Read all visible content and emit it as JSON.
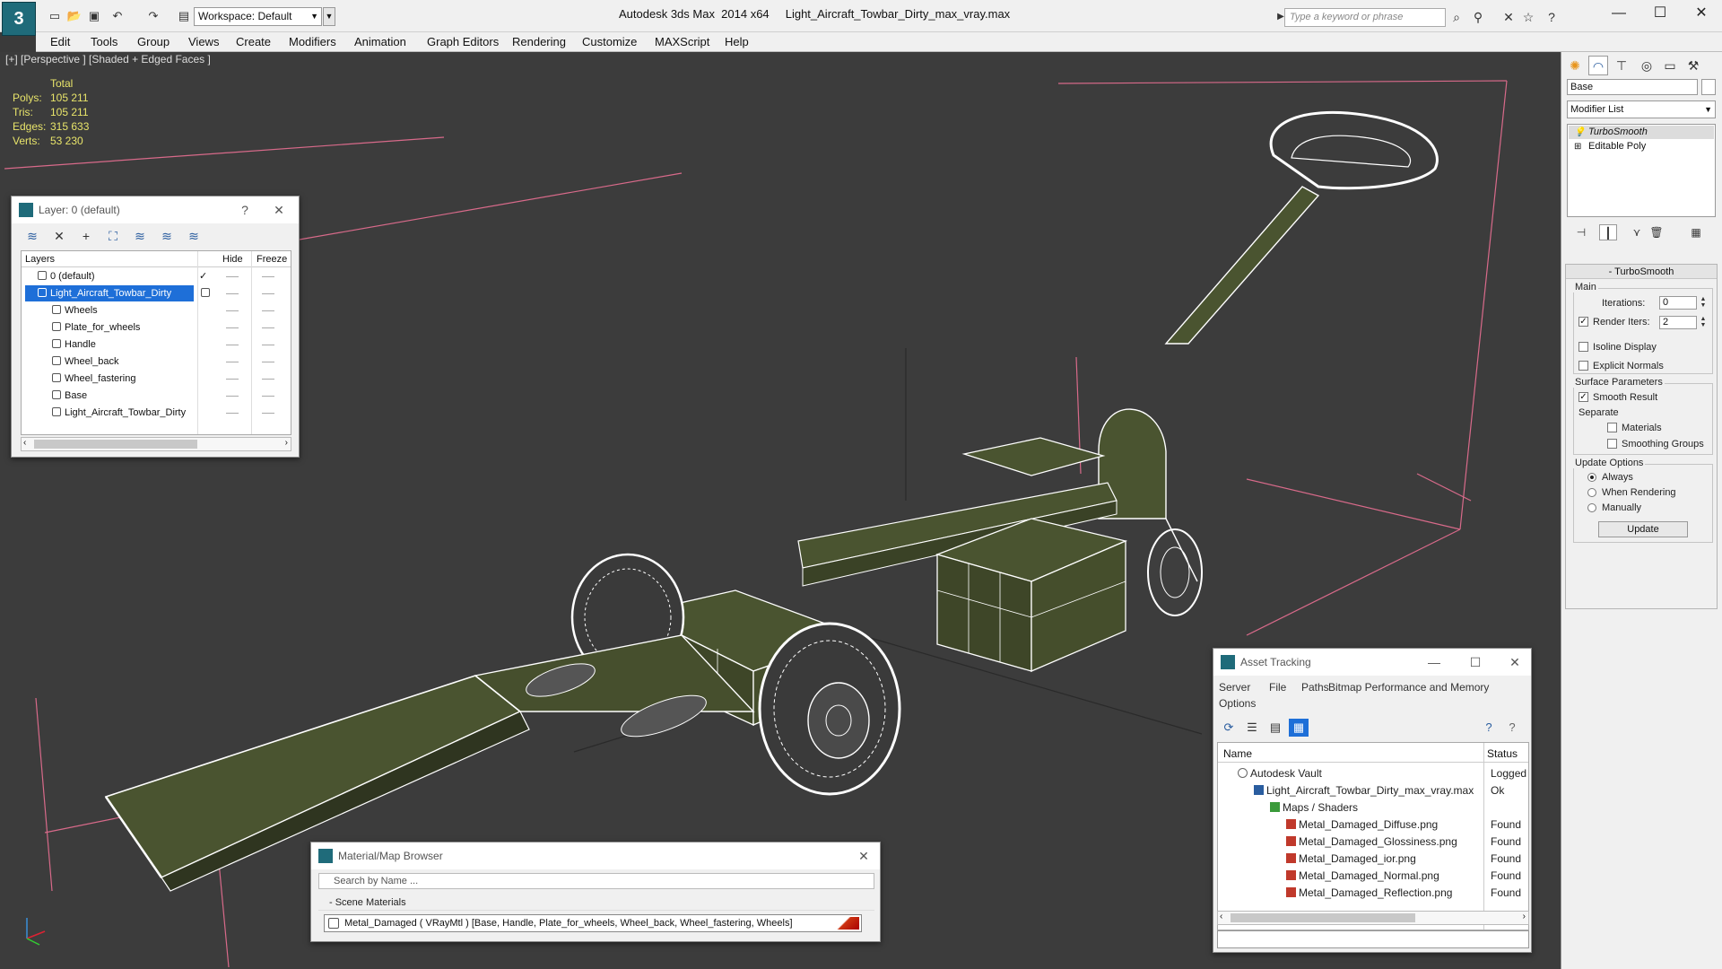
{
  "window": {
    "title": "Autodesk 3ds Max  2014 x64     Light_Aircraft_Towbar_Dirty_max_vray.max",
    "workspace": "Workspace: Default",
    "search_placeholder": "Type a keyword or phrase"
  },
  "menu": [
    "Edit",
    "Tools",
    "Group",
    "Views",
    "Create",
    "Modifiers",
    "Animation",
    "Graph Editors",
    "Rendering",
    "Customize",
    "MAXScript",
    "Help"
  ],
  "viewport": {
    "label": "[+] [Perspective ] [Shaded + Edged Faces ]",
    "stats": {
      "header": "Total",
      "rows": [
        {
          "key": "Polys:",
          "value": "105 211"
        },
        {
          "key": "Tris:",
          "value": "105 211"
        },
        {
          "key": "Edges:",
          "value": "315 633"
        },
        {
          "key": "Verts:",
          "value": "53 230"
        }
      ]
    }
  },
  "layer_panel": {
    "title": "Layer: 0 (default)",
    "help": "?",
    "columns": {
      "layers": "Layers",
      "hide": "Hide",
      "freeze": "Freeze"
    },
    "rows": [
      {
        "name": "0 (default)",
        "level": 0,
        "checked": true
      },
      {
        "name": "Light_Aircraft_Towbar_Dirty",
        "level": 0,
        "selected": true
      },
      {
        "name": "Wheels",
        "level": 1
      },
      {
        "name": "Plate_for_wheels",
        "level": 1
      },
      {
        "name": "Handle",
        "level": 1
      },
      {
        "name": "Wheel_back",
        "level": 1
      },
      {
        "name": "Wheel_fastering",
        "level": 1
      },
      {
        "name": "Base",
        "level": 1
      },
      {
        "name": "Light_Aircraft_Towbar_Dirty",
        "level": 1
      }
    ]
  },
  "material_browser": {
    "title": "Material/Map Browser",
    "search": "Search by Name ...",
    "section": "- Scene Materials",
    "material": "Metal_Damaged  ( VRayMtl ) [Base, Handle, Plate_for_wheels, Wheel_back, Wheel_fastering, Wheels]"
  },
  "asset_tracking": {
    "title": "Asset Tracking",
    "menu": [
      "Server",
      "File",
      "Paths",
      "Bitmap Performance and Memory",
      "Options"
    ],
    "columns": {
      "name": "Name",
      "status": "Status"
    },
    "rows": [
      {
        "name": "Autodesk Vault",
        "status": "Logged O",
        "level": 1,
        "icon": "vault"
      },
      {
        "name": "Light_Aircraft_Towbar_Dirty_max_vray.max",
        "status": "Ok",
        "level": 2,
        "icon": "max"
      },
      {
        "name": "Maps / Shaders",
        "status": "",
        "level": 3,
        "icon": "maps"
      },
      {
        "name": "Metal_Damaged_Diffuse.png",
        "status": "Found",
        "level": 4,
        "icon": "png"
      },
      {
        "name": "Metal_Damaged_Glossiness.png",
        "status": "Found",
        "level": 4,
        "icon": "png"
      },
      {
        "name": "Metal_Damaged_ior.png",
        "status": "Found",
        "level": 4,
        "icon": "png"
      },
      {
        "name": "Metal_Damaged_Normal.png",
        "status": "Found",
        "level": 4,
        "icon": "png"
      },
      {
        "name": "Metal_Damaged_Reflection.png",
        "status": "Found",
        "level": 4,
        "icon": "png"
      }
    ]
  },
  "command_panel": {
    "object_name": "Base",
    "modifier_list": "Modifier List",
    "stack": [
      {
        "name": "TurboSmooth",
        "italic": true
      },
      {
        "name": "Editable Poly",
        "italic": false
      }
    ],
    "turbosmooth": {
      "title": "TurboSmooth",
      "main": "Main",
      "iterations_label": "Iterations:",
      "iterations": "0",
      "render_iters_label": "Render Iters:",
      "render_iters": "2",
      "render_iters_checked": true,
      "isoline": "Isoline Display",
      "explicit_normals": "Explicit Normals",
      "surface_params": "Surface Parameters",
      "smooth_result": "Smooth Result",
      "separate": "Separate",
      "materials": "Materials",
      "smoothing_groups": "Smoothing Groups",
      "update_options": "Update Options",
      "always": "Always",
      "when_rendering": "When Rendering",
      "manually": "Manually",
      "update": "Update"
    }
  },
  "colors": {
    "viewport_bg": "#3c3c3c",
    "stats_text": "#e8e46a",
    "model_fill": "#4a5430",
    "wire": "#ffffff",
    "selection": "#1e6fd8",
    "bounds": "#d86a8a"
  }
}
